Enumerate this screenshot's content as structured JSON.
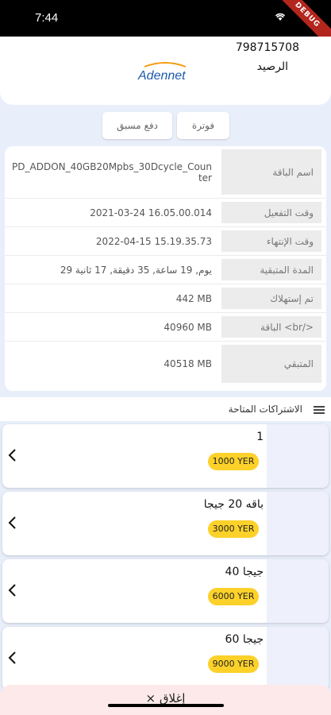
{
  "status_bar": {
    "time": "7:44",
    "debug_badge": "DEBUG"
  },
  "header": {
    "account_number": "798715708",
    "balance_label": "الرصيد",
    "logo_text": "Adennet",
    "logo_colors": {
      "blue": "#1e5aa8",
      "orange": "#f39c12"
    }
  },
  "actions": {
    "prepaid_label": "دفع مسبق",
    "invoice_label": "فوترة"
  },
  "details": [
    {
      "label": "اسم الباقة",
      "value": "PD_ADDON_40GB20Mpbs_30Dcycle_Counter"
    },
    {
      "label": "وقت التفعيل",
      "value": "2021-03-24 16.05.00.014"
    },
    {
      "label": "وقت الإنتهاء",
      "value": "2022-04-15 15.19.35.73"
    },
    {
      "label": "المدة المتبقية",
      "value": "يوم, 19 ساعة, 35 دقيقة, 17 ثانية 29"
    },
    {
      "label": "تم إستهلاك",
      "value": "442 MB"
    },
    {
      "label": "الباقة <br/>",
      "value": "40960 MB"
    },
    {
      "label": "المتبقي",
      "value": "40518 MB"
    }
  ],
  "subscriptions": {
    "title": "الاشتراكات المتاحة",
    "items": [
      {
        "name": "1",
        "price": "1000 YER"
      },
      {
        "name": "باقه 20 جيجا",
        "price": "3000 YER"
      },
      {
        "name": "40 جيجا",
        "price": "6000 YER"
      },
      {
        "name": "60 جيجا",
        "price": "9000 YER"
      }
    ]
  },
  "close": {
    "label": "× إغلاق"
  },
  "colors": {
    "price_badge": "#fcd12a",
    "background": "#e9eefb",
    "close_bar": "#fde9e9"
  }
}
